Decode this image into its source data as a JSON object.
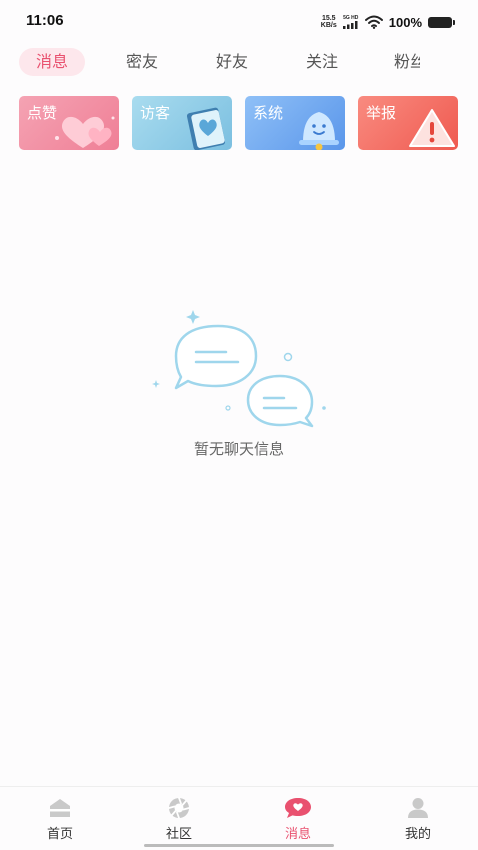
{
  "status_bar": {
    "time": "11:06",
    "net_speed_value": "15.5",
    "net_speed_unit": "KB/s",
    "signal_label": "5G HD",
    "battery": "100%"
  },
  "tabs": [
    {
      "label": "消息",
      "active": true
    },
    {
      "label": "密友",
      "active": false
    },
    {
      "label": "好友",
      "active": false
    },
    {
      "label": "关注",
      "active": false
    },
    {
      "label": "粉丝",
      "active": false
    }
  ],
  "cards": [
    {
      "label": "点赞",
      "icon": "hearts-icon",
      "color": "#f2889d"
    },
    {
      "label": "访客",
      "icon": "visitor-book-icon",
      "color": "#8ccbe8"
    },
    {
      "label": "系统",
      "icon": "bell-icon",
      "color": "#6fa8f2"
    },
    {
      "label": "举报",
      "icon": "warning-icon",
      "color": "#f2665c"
    }
  ],
  "empty_state": {
    "icon": "chat-bubbles-icon",
    "text": "暂无聊天信息"
  },
  "bottom_nav": [
    {
      "label": "首页",
      "icon": "home-icon",
      "active": false
    },
    {
      "label": "社区",
      "icon": "community-icon",
      "active": false
    },
    {
      "label": "消息",
      "icon": "message-icon",
      "active": true
    },
    {
      "label": "我的",
      "icon": "profile-icon",
      "active": false
    }
  ],
  "colors": {
    "accent": "#e9516f",
    "accent_bg": "#fde7ec",
    "illustration": "#9fd6ec"
  }
}
